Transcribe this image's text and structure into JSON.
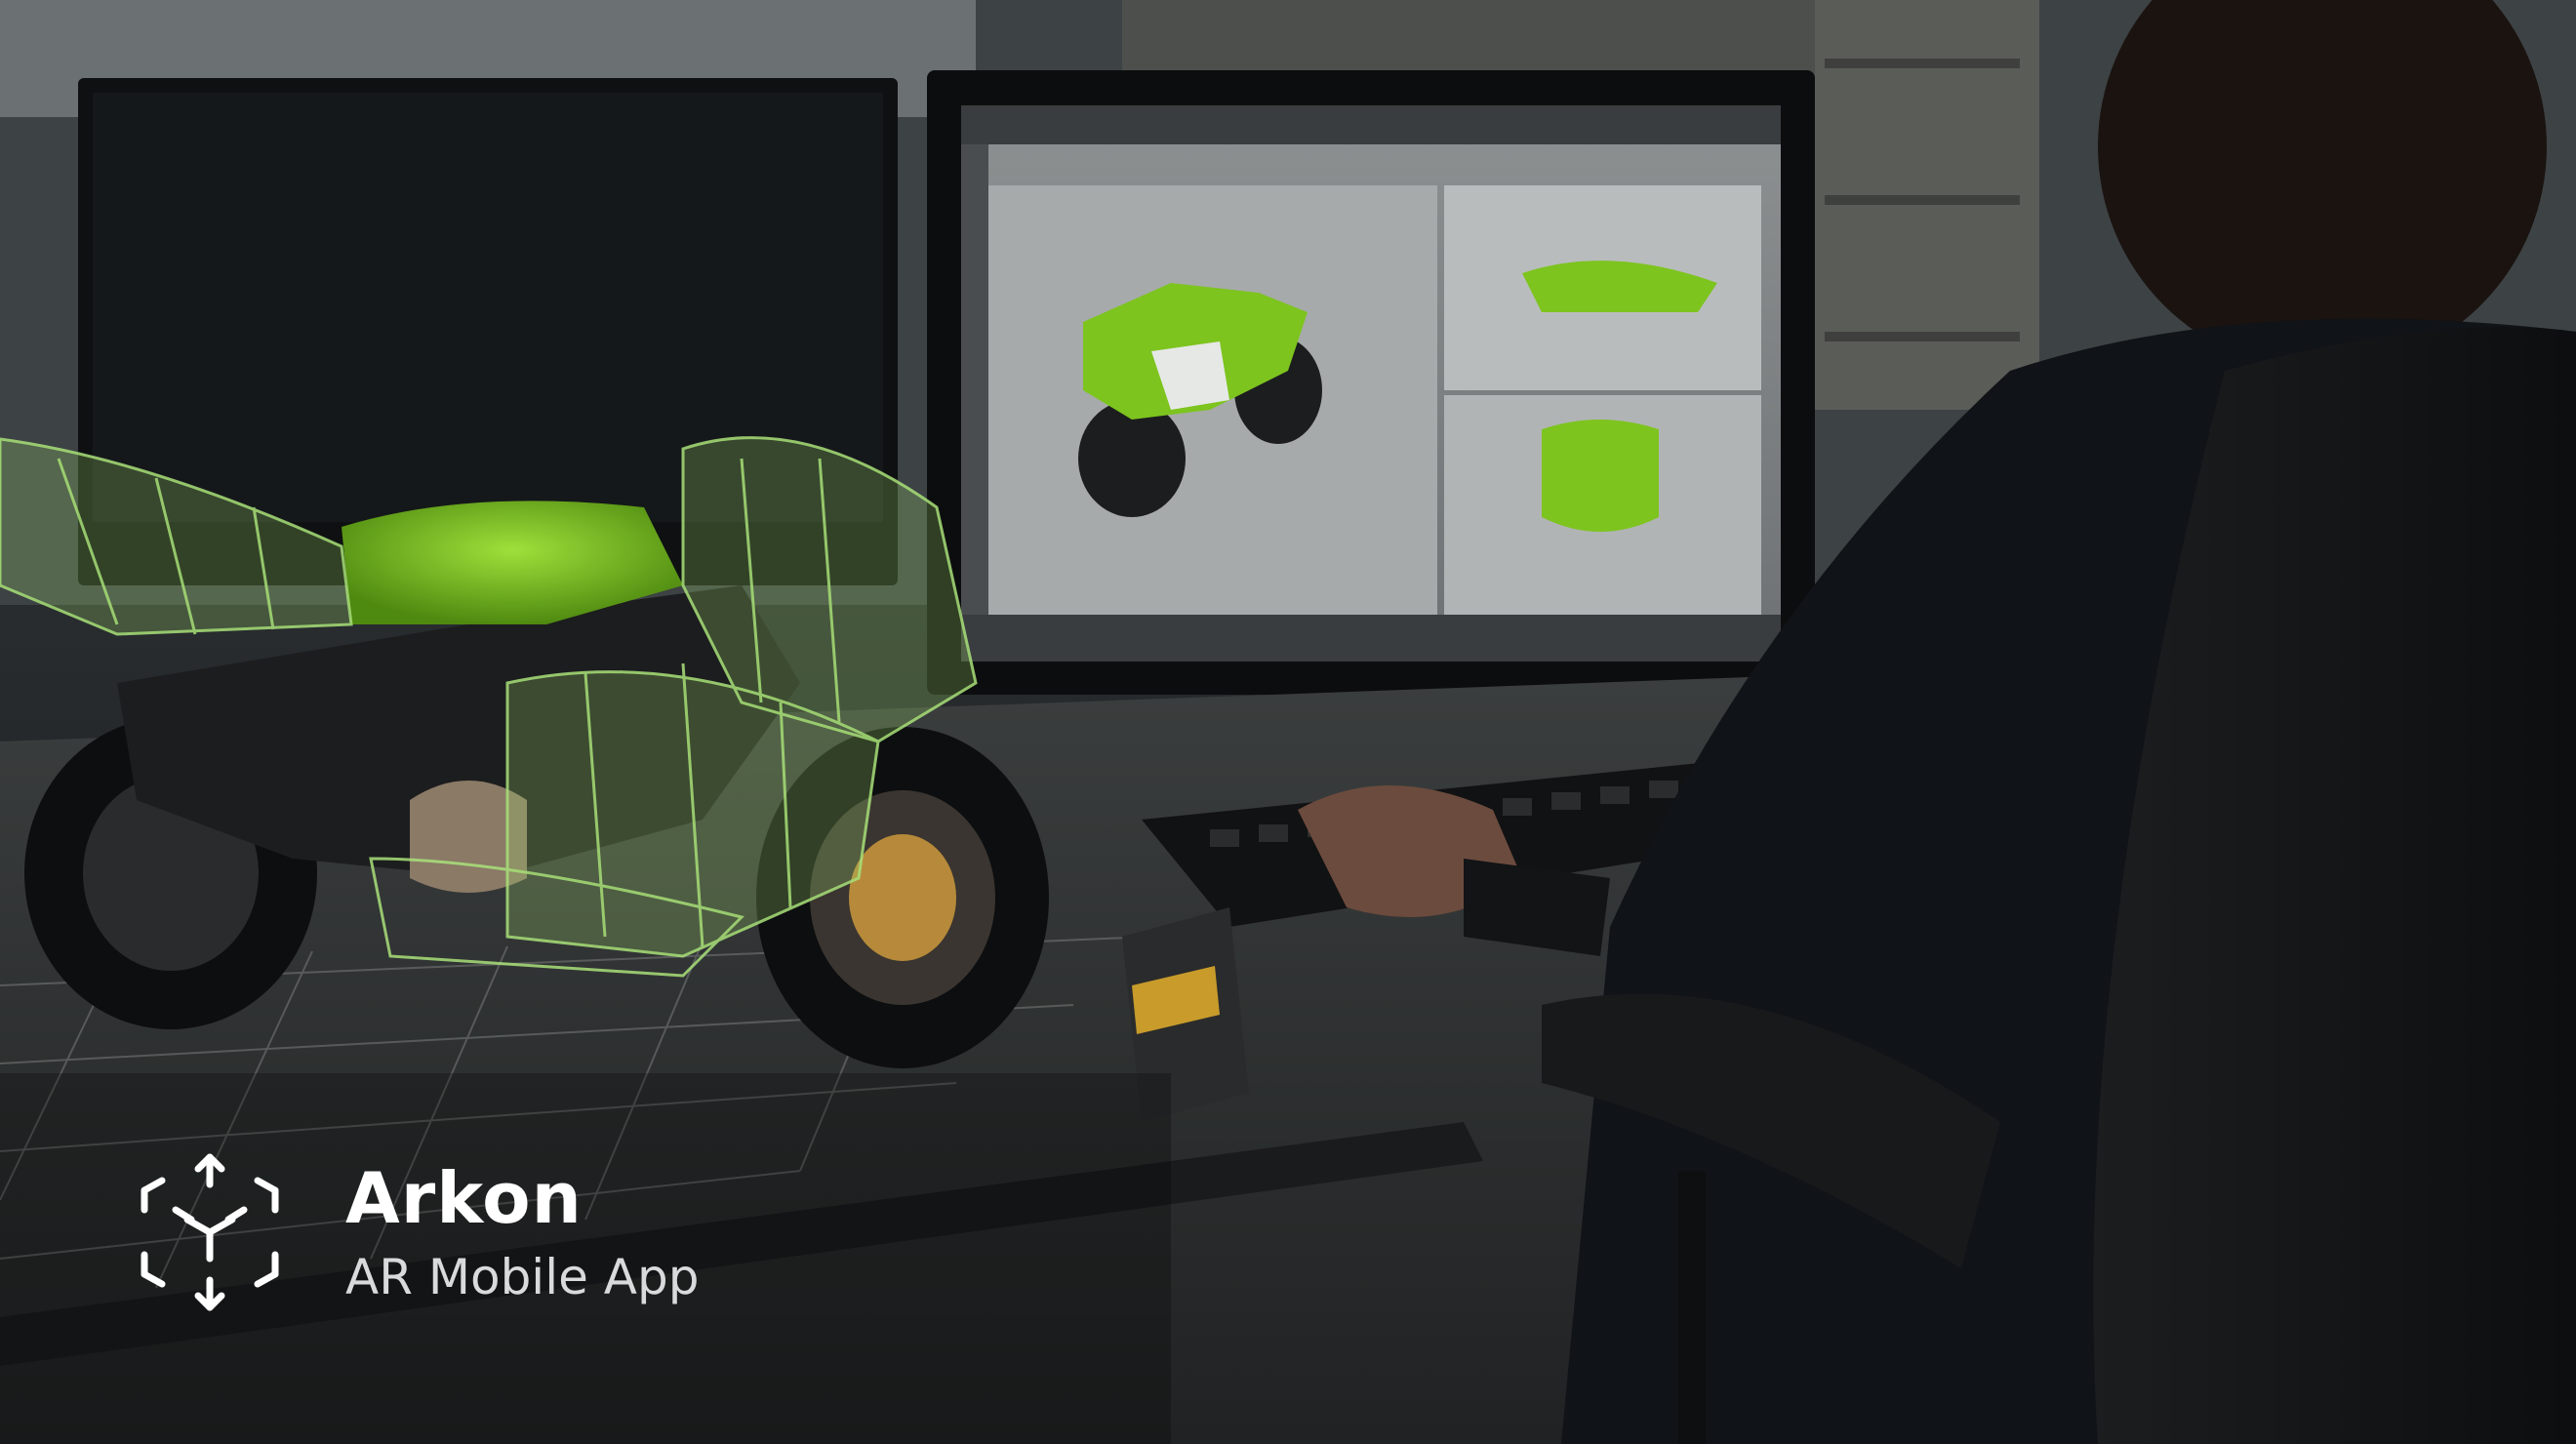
{
  "brand": {
    "name": "Arkon",
    "subtitle": "AR Mobile App",
    "logo_icon": "ar-cube-icon"
  },
  "colors": {
    "accent_green": "#7dc41f",
    "wireframe_green": "#a9e07a",
    "text_white": "#ffffff",
    "text_muted": "#d8dadb"
  }
}
